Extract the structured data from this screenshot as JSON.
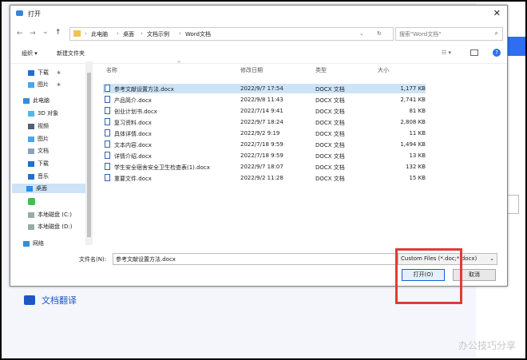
{
  "background": {
    "translate_label": "文档翻译",
    "watermark": "办公技巧分享"
  },
  "dialog": {
    "title": "打开",
    "close": "✕",
    "nav": {
      "back": "←",
      "forward": "→",
      "dropdown": "⌄",
      "up": "↑",
      "refresh": "↻"
    },
    "breadcrumb": [
      "此电脑",
      "桌面",
      "文档示例",
      "Word文档"
    ],
    "search_placeholder": "搜索\"Word文档\"",
    "toolbar": {
      "organize": "组织 ▾",
      "new_folder": "新建文件夹",
      "help": "?"
    },
    "sidebar": [
      {
        "label": "下载",
        "icon": "download-arrow-icon",
        "pinned": true
      },
      {
        "label": "图片",
        "icon": "pictures-icon",
        "pinned": true
      },
      {
        "label": "此电脑",
        "icon": "computer-icon"
      },
      {
        "label": "3D 对象",
        "icon": "3d-objects-icon"
      },
      {
        "label": "视频",
        "icon": "video-icon"
      },
      {
        "label": "图片",
        "icon": "pictures-icon"
      },
      {
        "label": "文档",
        "icon": "documents-icon"
      },
      {
        "label": "下载",
        "icon": "download-arrow-icon"
      },
      {
        "label": "音乐",
        "icon": "music-icon"
      },
      {
        "label": "桌面",
        "icon": "desktop-icon",
        "selected": true
      },
      {
        "label": "",
        "icon": "green-drive-icon"
      },
      {
        "label": "本地磁盘 (C:)",
        "icon": "drive-icon"
      },
      {
        "label": "本地磁盘 (D:)",
        "icon": "drive-icon"
      },
      {
        "label": "网络",
        "icon": "network-icon"
      }
    ],
    "columns": [
      "名称",
      "修改日期",
      "类型",
      "大小"
    ],
    "files": [
      {
        "name": "参考文献设置方法.docx",
        "date": "2022/9/7 17:54",
        "type": "DOCX 文档",
        "size": "1,177 KB"
      },
      {
        "name": "产品简介.docx",
        "date": "2022/9/8 11:43",
        "type": "DOCX 文档",
        "size": "2,741 KB"
      },
      {
        "name": "创业计划书.docx",
        "date": "2022/7/14 9:41",
        "type": "DOCX 文档",
        "size": "81 KB"
      },
      {
        "name": "复习资料.docx",
        "date": "2022/9/7 18:24",
        "type": "DOCX 文档",
        "size": "2,808 KB"
      },
      {
        "name": "具体详情.docx",
        "date": "2022/9/2 9:19",
        "type": "DOCX 文档",
        "size": "11 KB"
      },
      {
        "name": "文本内容.docx",
        "date": "2022/7/18 9:59",
        "type": "DOCX 文档",
        "size": "1,494 KB"
      },
      {
        "name": "详情介绍.docx",
        "date": "2022/7/18 9:59",
        "type": "DOCX 文档",
        "size": "13 KB"
      },
      {
        "name": "学生安全宿舍安全卫生检查表(1).docx",
        "date": "2022/9/7 18:07",
        "type": "DOCX 文档",
        "size": "132 KB"
      },
      {
        "name": "重要文件.docx",
        "date": "2022/9/2 11:28",
        "type": "DOCX 文档",
        "size": "15 KB"
      }
    ],
    "filename_label": "文件名(N):",
    "filename_value": "参考文献设置方法.docx",
    "filetype_value": "Custom Files (*.doc;*.docx)",
    "open_button": "打开(O)",
    "cancel_button": "取消"
  }
}
